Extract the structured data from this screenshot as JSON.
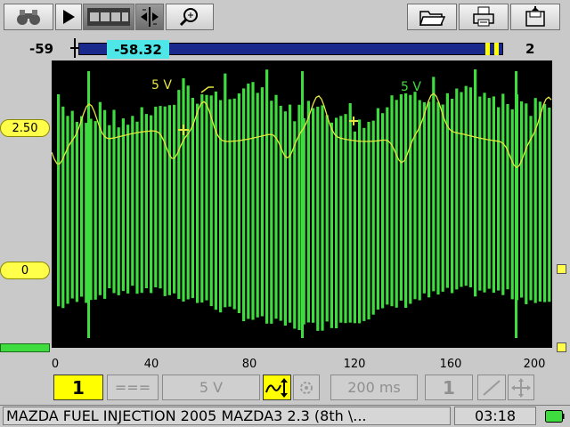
{
  "toolbar": {
    "left": [
      {
        "name": "binoculars-icon"
      },
      {
        "name": "play-icon"
      },
      {
        "name": "film-strip-icon"
      },
      {
        "name": "split-cursor-icon"
      },
      {
        "name": "zoom-icon"
      }
    ],
    "right": [
      {
        "name": "open-folder-icon"
      },
      {
        "name": "print-icon"
      },
      {
        "name": "save-disk-icon"
      }
    ]
  },
  "timebar": {
    "left_value": "-59",
    "cursor_value": "-58.32",
    "right_value": "2"
  },
  "scope": {
    "channel_a_label": "5 V",
    "channel_b_label": "5 V",
    "level_marker_top": "2.50",
    "level_marker_zero": "0",
    "x_ticks": [
      "0",
      "40",
      "80",
      "120",
      "160",
      "200"
    ]
  },
  "controls": {
    "channel_number": "1",
    "coupling": "===",
    "volts_per_div": "5 V",
    "time_per_div": "200 ms",
    "trigger_channel": "1"
  },
  "status": {
    "vehicle_text": "MAZDA FUEL INJECTION 2005 MAZDA3 2.3 (8th \\...",
    "clock": "03:18"
  },
  "colors": {
    "channel_1": "#3fdc3f",
    "channel_2": "#e6e640",
    "timebar": "#1a2a8c",
    "highlight": "#ffff00"
  }
}
